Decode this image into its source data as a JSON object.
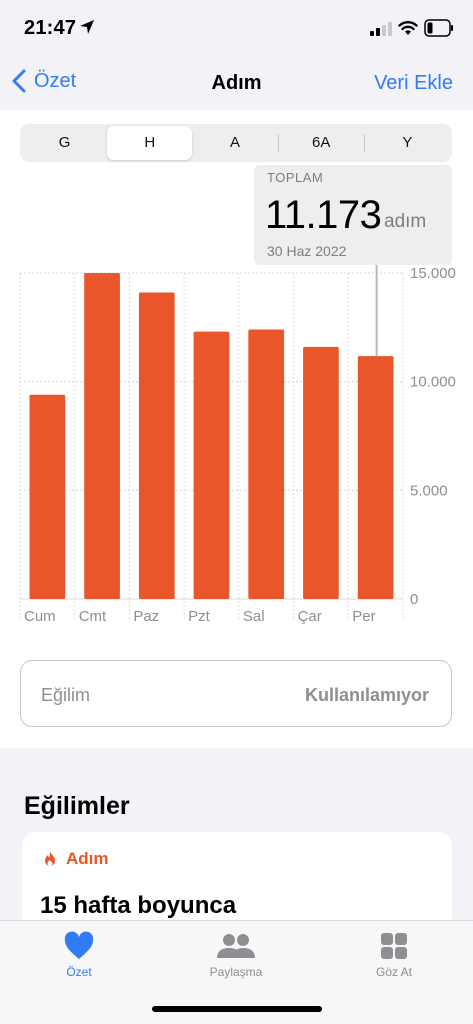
{
  "status_bar": {
    "time": "21:47"
  },
  "nav": {
    "back_label": "Özet",
    "title": "Adım",
    "action_label": "Veri Ekle"
  },
  "segments": [
    {
      "label": "G",
      "active": false
    },
    {
      "label": "H",
      "active": true
    },
    {
      "label": "A",
      "active": false
    },
    {
      "label": "6A",
      "active": false
    },
    {
      "label": "Y",
      "active": false
    }
  ],
  "summary": {
    "label": "TOPLAM",
    "value": "11.173",
    "unit": "adım",
    "date": "30 Haz 2022"
  },
  "trend": {
    "label": "Eğilim",
    "value": "Kullanılamıyor"
  },
  "trends_section": {
    "title": "Eğilimler",
    "card_tag": "Adım",
    "card_headline": "15 hafta boyunca"
  },
  "tabs": [
    {
      "label": "Özet",
      "icon": "heart-icon",
      "active": true
    },
    {
      "label": "Paylaşma",
      "icon": "people-icon",
      "active": false
    },
    {
      "label": "Göz At",
      "icon": "grid-icon",
      "active": false
    }
  ],
  "colors": {
    "accent": "#2f7cf6",
    "bar": "#e8562a"
  },
  "chart_data": {
    "type": "bar",
    "categories": [
      "Cum",
      "Cmt",
      "Paz",
      "Pzt",
      "Sal",
      "Çar",
      "Per"
    ],
    "values": [
      9400,
      15000,
      14100,
      12300,
      12400,
      11600,
      11173
    ],
    "y_ticks": [
      "0",
      "5.000",
      "10.000",
      "15.000"
    ],
    "y_tick_values": [
      0,
      5000,
      10000,
      15000
    ],
    "ylim": [
      0,
      15000
    ],
    "highlight_index": 6
  }
}
